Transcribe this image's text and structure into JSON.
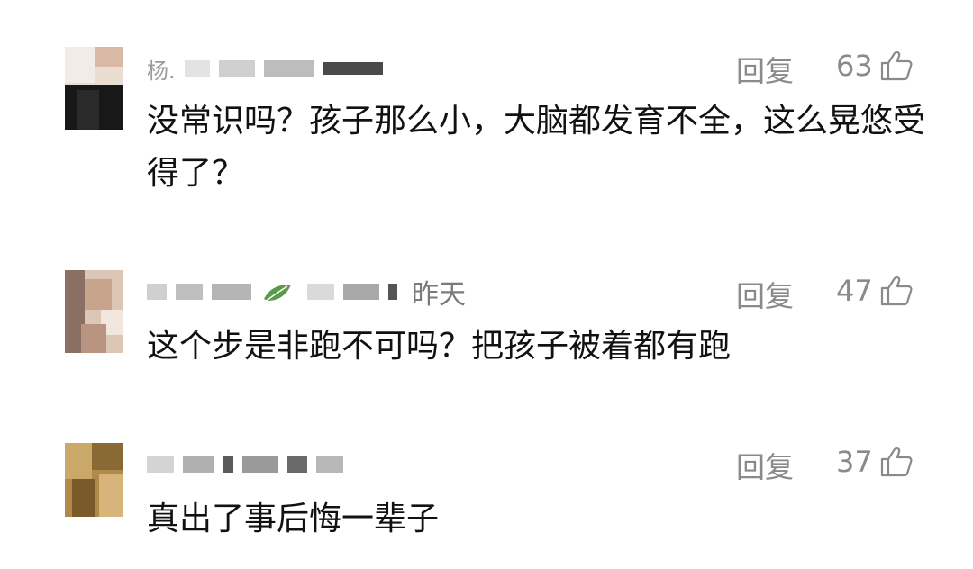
{
  "comments": [
    {
      "username_prefix": "杨.",
      "time": "",
      "reply_label": "回复",
      "likes": "63",
      "text": "没常识吗？孩子那么小，大脑都发育不全，这么晃悠受得了？"
    },
    {
      "username_prefix": "",
      "time": "昨天",
      "reply_label": "回复",
      "likes": "47",
      "text": "这个步是非跑不可吗？把孩子被着都有跑"
    },
    {
      "username_prefix": "",
      "time": "",
      "reply_label": "回复",
      "likes": "37",
      "text": "真出了事后悔一辈子"
    }
  ],
  "colors": {
    "meta_text": "#8a8a8a",
    "body_text": "#111111",
    "leaf_green": "#5a9a48"
  },
  "icons": {
    "like": "thumbs-up-outline-icon",
    "badge": "leaf-icon"
  }
}
